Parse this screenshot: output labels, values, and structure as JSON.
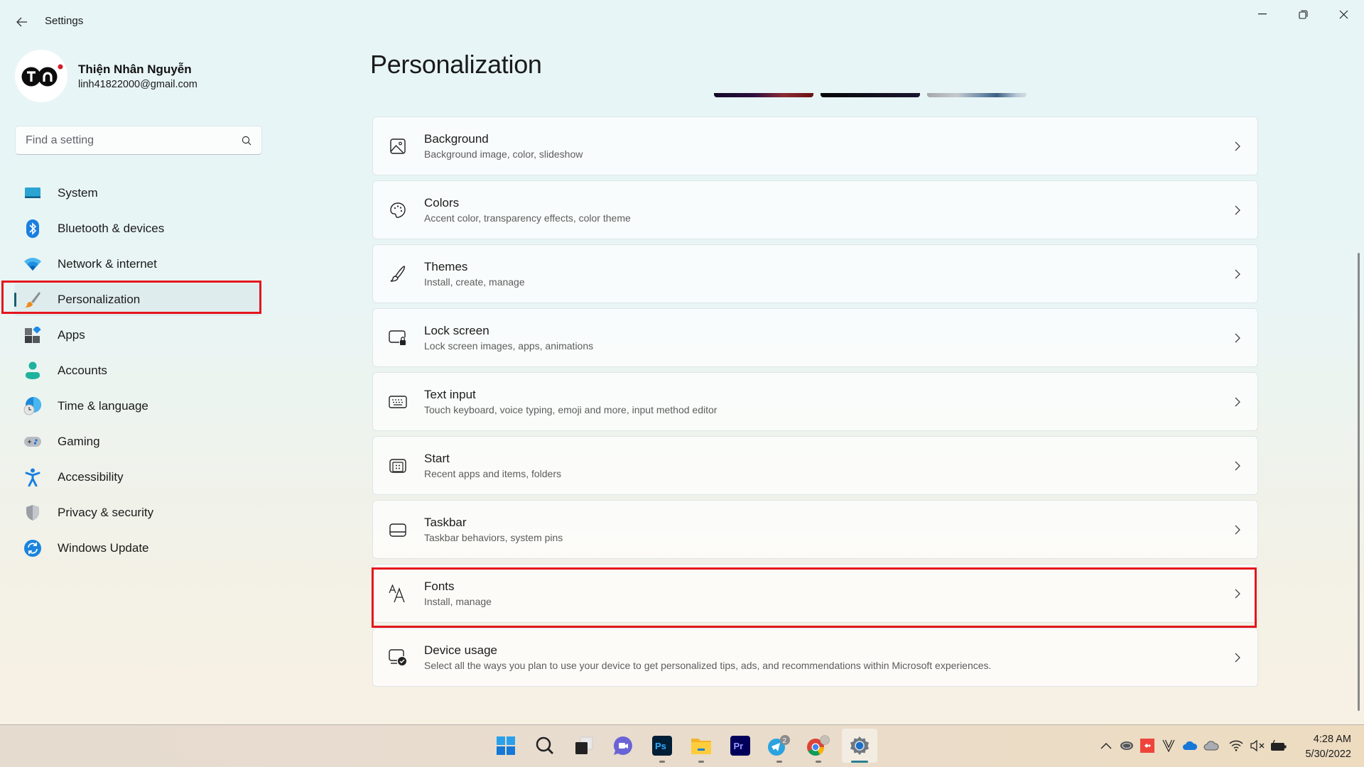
{
  "window": {
    "title": "Settings",
    "controls": [
      "minimize",
      "restore",
      "close"
    ]
  },
  "profile": {
    "initials": "TN",
    "name": "Thiện Nhân Nguyễn",
    "email": "linh41822000@gmail.com"
  },
  "search": {
    "placeholder": "Find a setting",
    "value": ""
  },
  "sidebar": {
    "items": [
      {
        "label": "System",
        "icon": "monitor-icon"
      },
      {
        "label": "Bluetooth & devices",
        "icon": "bluetooth-icon"
      },
      {
        "label": "Network & internet",
        "icon": "wifi-icon"
      },
      {
        "label": "Personalization",
        "icon": "paintbrush-icon",
        "selected": true
      },
      {
        "label": "Apps",
        "icon": "apps-icon"
      },
      {
        "label": "Accounts",
        "icon": "person-icon"
      },
      {
        "label": "Time & language",
        "icon": "globe-clock-icon"
      },
      {
        "label": "Gaming",
        "icon": "gamepad-icon"
      },
      {
        "label": "Accessibility",
        "icon": "accessibility-icon"
      },
      {
        "label": "Privacy & security",
        "icon": "shield-icon"
      },
      {
        "label": "Windows Update",
        "icon": "update-icon"
      }
    ]
  },
  "main": {
    "title": "Personalization",
    "cards": [
      {
        "title": "Background",
        "subtitle": "Background image, color, slideshow",
        "icon": "image-icon"
      },
      {
        "title": "Colors",
        "subtitle": "Accent color, transparency effects, color theme",
        "icon": "palette-icon"
      },
      {
        "title": "Themes",
        "subtitle": "Install, create, manage",
        "icon": "brush-icon"
      },
      {
        "title": "Lock screen",
        "subtitle": "Lock screen images, apps, animations",
        "icon": "lock-screen-icon"
      },
      {
        "title": "Text input",
        "subtitle": "Touch keyboard, voice typing, emoji and more, input method editor",
        "icon": "keyboard-icon"
      },
      {
        "title": "Start",
        "subtitle": "Recent apps and items, folders",
        "icon": "start-icon"
      },
      {
        "title": "Taskbar",
        "subtitle": "Taskbar behaviors, system pins",
        "icon": "taskbar-icon"
      },
      {
        "title": "Fonts",
        "subtitle": "Install, manage",
        "icon": "fonts-icon",
        "highlighted": true
      },
      {
        "title": "Device usage",
        "subtitle": "Select all the ways you plan to use your device to get personalized tips, ads, and recommendations within Microsoft experiences.",
        "icon": "device-usage-icon"
      }
    ]
  },
  "annotations": {
    "highlight_color": "#e3161c"
  },
  "taskbar": {
    "apps": [
      {
        "name": "start",
        "icon": "windows-logo-icon"
      },
      {
        "name": "search",
        "icon": "search-icon"
      },
      {
        "name": "task-view",
        "icon": "task-view-icon"
      },
      {
        "name": "chat",
        "icon": "teams-chat-icon"
      },
      {
        "name": "photoshop",
        "icon": "photoshop-icon",
        "label": "Ps",
        "running": true
      },
      {
        "name": "file-explorer",
        "icon": "folder-icon",
        "running": true
      },
      {
        "name": "premiere",
        "icon": "premiere-icon",
        "label": "Pr"
      },
      {
        "name": "telegram",
        "icon": "telegram-icon",
        "badge": "2",
        "running": true
      },
      {
        "name": "chrome",
        "icon": "chrome-icon",
        "running": true
      },
      {
        "name": "settings",
        "icon": "settings-gear-icon",
        "active": true
      }
    ],
    "tray": [
      "chevron-up-icon",
      "creative-cloud-icon",
      "anydesk-icon",
      "vectorworks-icon",
      "onedrive-icon",
      "cloud-icon",
      "wifi-icon",
      "volume-muted-icon",
      "battery-charging-icon"
    ],
    "time": "4:28 AM",
    "date": "5/30/2022"
  }
}
